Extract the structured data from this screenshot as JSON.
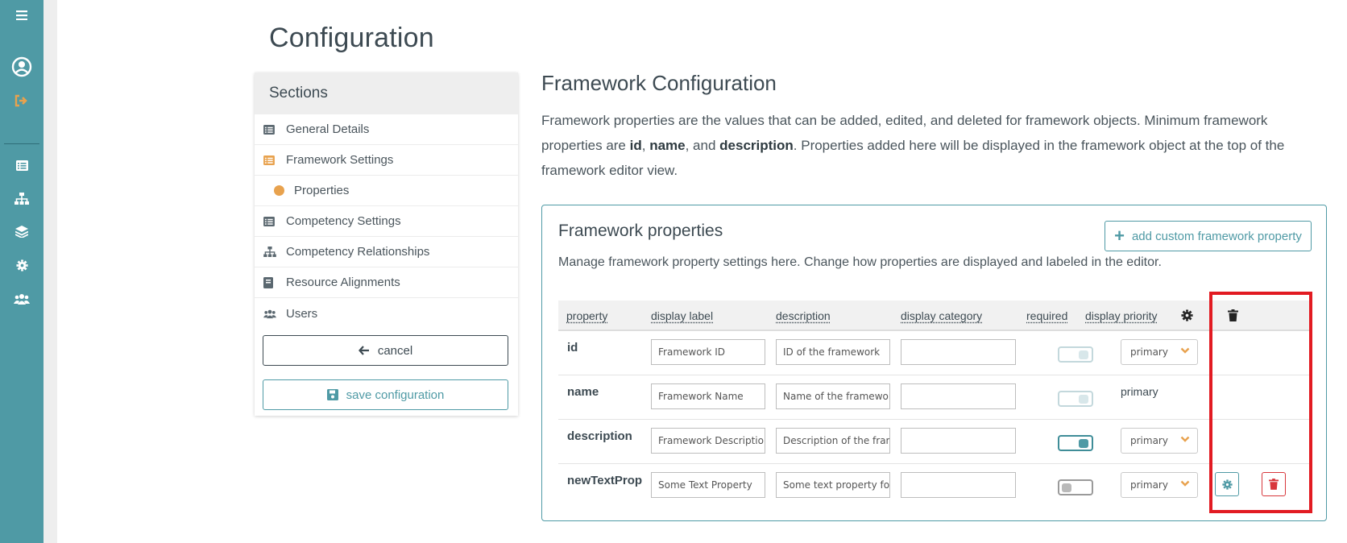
{
  "page_title": "Configuration",
  "nav_rail": {
    "icons": [
      "menu-icon",
      "user-circle-icon",
      "sign-out-icon",
      "list-icon",
      "sitemap-icon",
      "layers-icon",
      "gear-icon",
      "users-icon"
    ]
  },
  "sections": {
    "heading": "Sections",
    "items": [
      {
        "label": "General Details",
        "icon": "list-icon"
      },
      {
        "label": "Framework Settings",
        "icon": "list-icon",
        "active": true
      },
      {
        "label": "Properties",
        "icon": "dot-icon",
        "sub": true
      },
      {
        "label": "Competency Settings",
        "icon": "list-icon"
      },
      {
        "label": "Competency Relationships",
        "icon": "sitemap-icon"
      },
      {
        "label": "Resource Alignments",
        "icon": "book-icon"
      },
      {
        "label": "Users",
        "icon": "users-icon"
      }
    ],
    "cancel_label": "cancel",
    "save_label": "save configuration"
  },
  "main": {
    "heading": "Framework Configuration",
    "intro": {
      "part1": "Framework properties are the values that can be added, edited, and deleted for framework objects. Minimum framework properties are ",
      "bold1": "id",
      "sep1": ", ",
      "bold2": "name",
      "sep2": ", and ",
      "bold3": "description",
      "part2": ". Properties added here will be displayed in the framework object at the top of the framework editor view."
    }
  },
  "framework_properties": {
    "title": "Framework properties",
    "description": "Manage framework property settings here. Change how properties are displayed and labeled in the editor.",
    "add_button_label": "add custom framework property",
    "columns": [
      "property",
      "display label",
      "description",
      "display category",
      "required",
      "display priority"
    ],
    "header_icons": [
      "gear-icon",
      "trash-icon"
    ],
    "rows": [
      {
        "property": "id",
        "display_label": "Framework ID",
        "description": "ID of the framework",
        "display_category": "",
        "required": "disabled-on",
        "priority": "primary",
        "priority_editable": true,
        "actions": false
      },
      {
        "property": "name",
        "display_label": "Framework Name",
        "description": "Name of the framework",
        "display_category": "",
        "required": "disabled-on",
        "priority": "primary",
        "priority_editable": false,
        "actions": false
      },
      {
        "property": "description",
        "display_label": "Framework Description",
        "description": "Description of the framework",
        "display_category": "",
        "required": "on",
        "priority": "primary",
        "priority_editable": true,
        "actions": false
      },
      {
        "property": "newTextProp",
        "display_label": "Some Text Property",
        "description": "Some text property for the framework",
        "display_category": "",
        "required": "off",
        "priority": "primary",
        "priority_editable": true,
        "actions": true
      }
    ]
  },
  "colors": {
    "rail": "#4f9aa5",
    "accent": "#4f9aa5",
    "orange": "#e8a24e",
    "danger": "#d8373c",
    "highlight": "#e21b22"
  }
}
